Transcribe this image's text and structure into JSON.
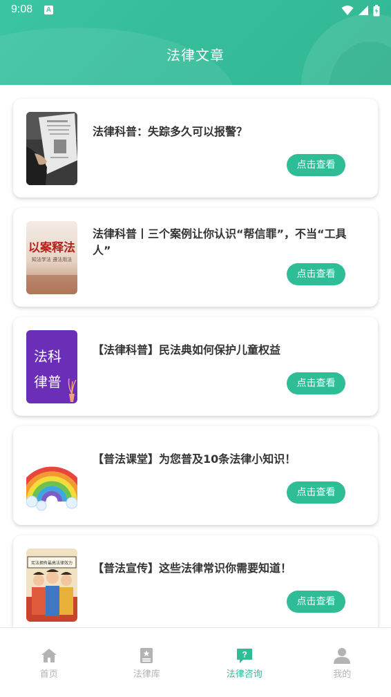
{
  "status_bar": {
    "time": "9:08",
    "notification_glyph": "A"
  },
  "header": {
    "title": "法律文章"
  },
  "colors": {
    "accent": "#2fbd98",
    "header_bg": "#3cc5a3",
    "inactive": "#b3b3b3"
  },
  "articles": [
    {
      "title": "法律科普：失踪多久可以报警？",
      "button": "点击查看",
      "thumbnail": "newspaper-photo"
    },
    {
      "title": "法律科普丨三个案例让你认识“帮信罪”，不当“工具人”",
      "button": "点击查看",
      "thumbnail": "case-law-poster",
      "thumb_text": "以案释法",
      "thumb_subtext": "知法学法 遵法用法"
    },
    {
      "title": "【法律科普】民法典如何保护儿童权益",
      "button": "点击查看",
      "thumbnail": "purple-poster",
      "thumb_text_1": "法科",
      "thumb_text_2": "律普"
    },
    {
      "title": "【普法课堂】为您普及10条法律小知识！",
      "button": "点击查看",
      "thumbnail": "rainbow-illustration"
    },
    {
      "title": "【普法宣传】这些法律常识你需要知道！",
      "button": "点击查看",
      "thumbnail": "crowd-illustration",
      "thumb_banner": "宪法拥有最高法律效力"
    }
  ],
  "bottom_nav": [
    {
      "label": "首页",
      "icon": "home-icon",
      "active": false
    },
    {
      "label": "法律库",
      "icon": "library-icon",
      "active": false
    },
    {
      "label": "法律咨询",
      "icon": "consult-icon",
      "active": true
    },
    {
      "label": "我的",
      "icon": "profile-icon",
      "active": false
    }
  ]
}
